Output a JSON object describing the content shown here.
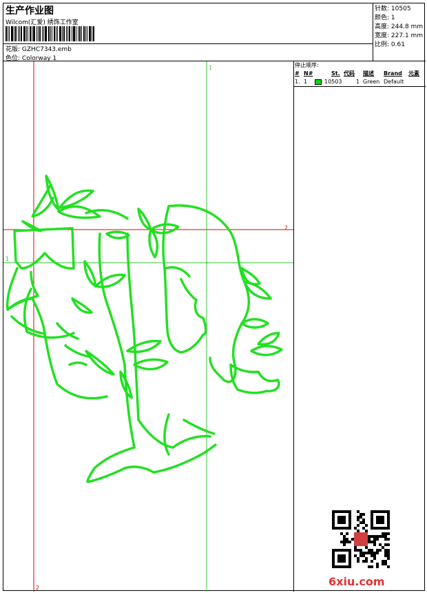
{
  "header": {
    "title": "生产作业图",
    "company": "Wilcom(汇爱) 绣饰工作室",
    "file_label": "花版:",
    "file_value": "GZHC7343.emb",
    "color_label": "色位:",
    "color_value": "Colorway 1"
  },
  "stats": [
    {
      "label": "针数:",
      "value": "10505"
    },
    {
      "label": "颜色:",
      "value": "1"
    },
    {
      "label": "高度:",
      "value": "244.8 mm"
    },
    {
      "label": "宽度:",
      "value": "227.1 mm"
    },
    {
      "label": "比例:",
      "value": "0.61"
    }
  ],
  "stop_sequence": {
    "title": "停止顺序:",
    "headers": [
      "#",
      "N#",
      "St.",
      "代码",
      "描述",
      "Brand",
      "元素"
    ],
    "rows": [
      {
        "index": "1.",
        "n": "1",
        "swatch": "#00e000",
        "st": "10503",
        "code": "1",
        "desc": "Green",
        "brand": "Default"
      }
    ]
  },
  "guides": {
    "green_v": "1",
    "green_h": "1",
    "red_h": "2",
    "red_v": "2"
  },
  "watermark": "6xiu.com",
  "colors": {
    "design": "#22e022",
    "red_guide": "#e00000",
    "green_guide": "#30c030"
  }
}
